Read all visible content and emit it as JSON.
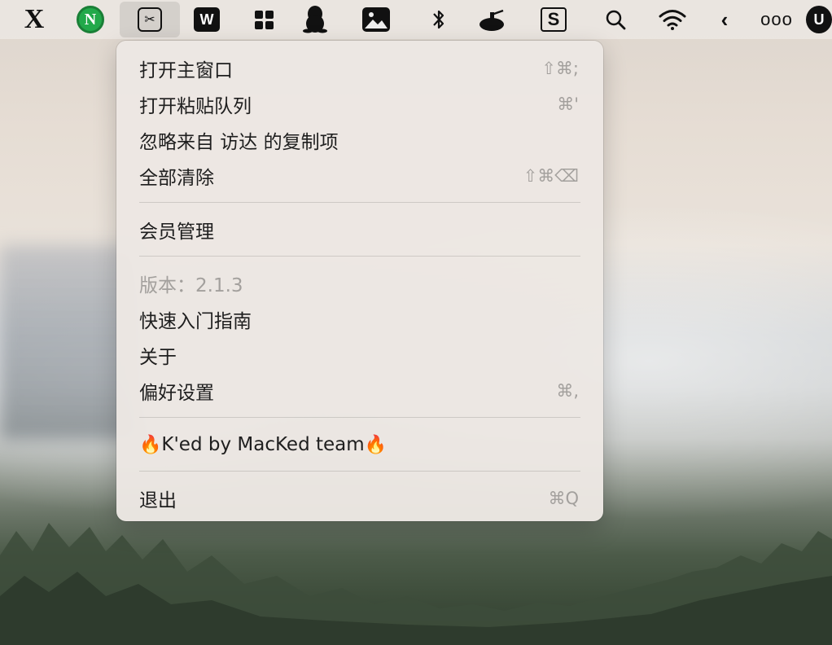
{
  "menubar": {
    "icons": [
      {
        "name": "x-app-icon",
        "glyph": "X"
      },
      {
        "name": "n-app-icon",
        "glyph": "N"
      },
      {
        "name": "clipboard-app-icon",
        "glyph": "✂"
      },
      {
        "name": "wps-office-icon",
        "glyph": "W"
      },
      {
        "name": "grid-app-icon",
        "glyph": ""
      },
      {
        "name": "qq-penguin-icon",
        "glyph": ""
      },
      {
        "name": "photo-app-icon",
        "glyph": ""
      },
      {
        "name": "bluetooth-icon",
        "glyph": "✱"
      },
      {
        "name": "tank-app-icon",
        "glyph": ""
      },
      {
        "name": "s-app-icon",
        "glyph": "S"
      },
      {
        "name": "search-icon",
        "glyph": ""
      },
      {
        "name": "wifi-icon",
        "glyph": ""
      },
      {
        "name": "chevron-left-icon",
        "glyph": "‹"
      },
      {
        "name": "more-dots-icon",
        "glyph": "ooo"
      },
      {
        "name": "user-app-icon",
        "glyph": "U"
      }
    ]
  },
  "menu": {
    "items": [
      {
        "label": "打开主窗口",
        "shortcut": "⇧⌘;"
      },
      {
        "label": "打开粘贴队列",
        "shortcut": "⌘'"
      },
      {
        "label": "忽略来自 访达 的复制项",
        "shortcut": ""
      },
      {
        "label": "全部清除",
        "shortcut": "⇧⌘⌫"
      },
      {
        "label": "会员管理",
        "shortcut": ""
      },
      {
        "label": "版本：2.1.3",
        "shortcut": ""
      },
      {
        "label": "快速入门指南",
        "shortcut": ""
      },
      {
        "label": "关于",
        "shortcut": ""
      },
      {
        "label": "偏好设置",
        "shortcut": "⌘,"
      },
      {
        "label": "K'ed by MacKed team",
        "shortcut": "",
        "emoji_left": "🔥",
        "emoji_right": "🔥"
      },
      {
        "label": "退出",
        "shortcut": "⌘Q"
      }
    ]
  },
  "colors": {
    "menu_background": "#ece7e3",
    "menu_text": "#1e1e1e",
    "shortcut_text": "#a3a09d",
    "accent_green": "#22a94a"
  }
}
